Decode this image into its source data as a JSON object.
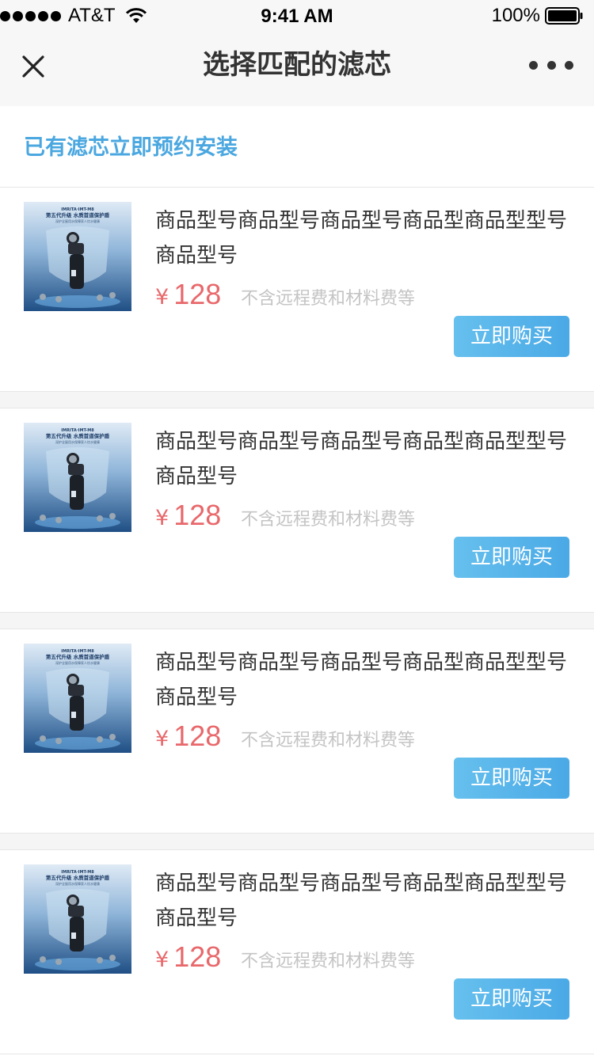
{
  "status_bar": {
    "carrier": "AT&T",
    "time": "9:41 AM",
    "battery": "100%"
  },
  "nav": {
    "title": "选择匹配的滤芯"
  },
  "booking": {
    "link_label": "已有滤芯立即预约安装"
  },
  "thumb_text": {
    "brand": "IMRITA·IMT-M8",
    "headline": "第五代升级 水质首道保护盾",
    "sub": "深护全屋用水保障家人饮水健康"
  },
  "products": [
    {
      "name": "商品型号商品型号商品型号商品型商品型型号商品型号",
      "currency": "¥",
      "price": "128",
      "note": "不含远程费和材料费等",
      "buy_label": "立即购买"
    },
    {
      "name": "商品型号商品型号商品型号商品型商品型型号商品型号",
      "currency": "¥",
      "price": "128",
      "note": "不含远程费和材料费等",
      "buy_label": "立即购买"
    },
    {
      "name": "商品型号商品型号商品型号商品型商品型型号商品型号",
      "currency": "¥",
      "price": "128",
      "note": "不含远程费和材料费等",
      "buy_label": "立即购买"
    },
    {
      "name": "商品型号商品型号商品型号商品型商品型型号商品型号",
      "currency": "¥",
      "price": "128",
      "note": "不含远程费和材料费等",
      "buy_label": "立即购买"
    }
  ],
  "colors": {
    "accent": "#4aa7e0",
    "price": "#e8686b",
    "muted": "#c4c4c4"
  }
}
